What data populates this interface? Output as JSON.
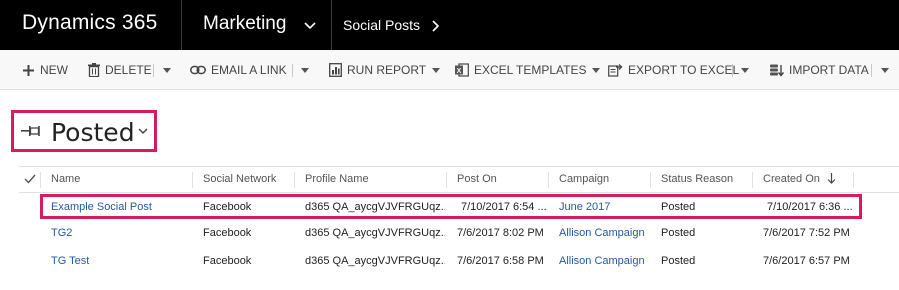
{
  "topbar": {
    "brand": "Dynamics 365",
    "module": "Marketing",
    "area": "Social Posts"
  },
  "commands": {
    "new": "NEW",
    "delete": "DELETE",
    "email_link": "EMAIL A LINK",
    "run_report": "RUN REPORT",
    "excel_templates": "EXCEL TEMPLATES",
    "export_excel": "EXPORT TO EXCEL",
    "import_data": "IMPORT DATA"
  },
  "view": {
    "title": "Posted"
  },
  "grid": {
    "columns": [
      "Name",
      "Social Network",
      "Profile Name",
      "Post On",
      "Campaign",
      "Status Reason",
      "Created On"
    ],
    "sorted_column": "Created On",
    "sort_direction": "descending",
    "rows": [
      {
        "name": "Example Social Post",
        "social_network": "Facebook",
        "profile_name": "d365 QA_aycgVJVFRGUqz...",
        "post_on": "7/10/2017 6:54 ...",
        "campaign": "June 2017",
        "status_reason": "Posted",
        "created_on": "7/10/2017 6:36 ..."
      },
      {
        "name": "TG2",
        "social_network": "Facebook",
        "profile_name": "d365 QA_aycgVJVFRGUqz...",
        "post_on": "7/6/2017 8:02 PM",
        "campaign": "Allison Campaign",
        "status_reason": "Posted",
        "created_on": "7/6/2017 7:52 PM"
      },
      {
        "name": "TG Test",
        "social_network": "Facebook",
        "profile_name": "d365 QA_aycgVJVFRGUqz...",
        "post_on": "7/6/2017 6:58 PM",
        "campaign": "Allison Campaign",
        "status_reason": "Posted",
        "created_on": "7/6/2017 6:57 PM"
      }
    ]
  },
  "colors": {
    "topbar_bg": "#000000",
    "highlight": "#d81b60",
    "link": "#2459a6"
  },
  "icons": {
    "view_selector": "pin-icon",
    "module_nav": "chevron-down-icon",
    "area_nav": "chevron-right-icon"
  }
}
